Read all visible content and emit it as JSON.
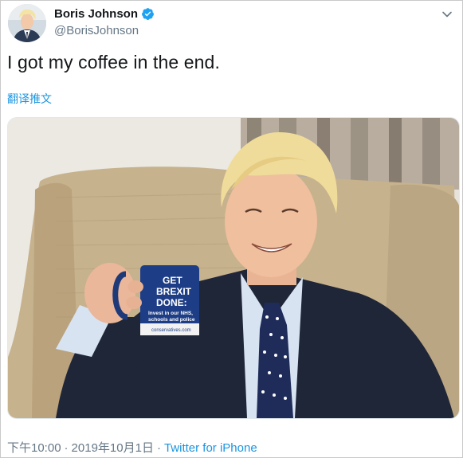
{
  "tweet": {
    "author": {
      "display_name": "Boris Johnson",
      "handle": "@BorisJohnson",
      "verified": true
    },
    "text": "I got my coffee in the end.",
    "translate_label": "翻译推文",
    "media": {
      "mug_lines": [
        "GET",
        "BREXIT",
        "DONE:",
        "Invest in our NHS,",
        "schools and police"
      ],
      "mug_url": "conservatives.com"
    },
    "meta": {
      "time": "下午10:00",
      "separator": "·",
      "date": "2019年10月1日",
      "source": "Twitter for iPhone"
    }
  },
  "icons": {
    "verified": "verified-badge-icon",
    "menu": "chevron-down-icon"
  },
  "colors": {
    "link": "#1b95e0",
    "verified": "#1da1f2",
    "secondary_text": "#657786",
    "primary_text": "#14171a"
  }
}
